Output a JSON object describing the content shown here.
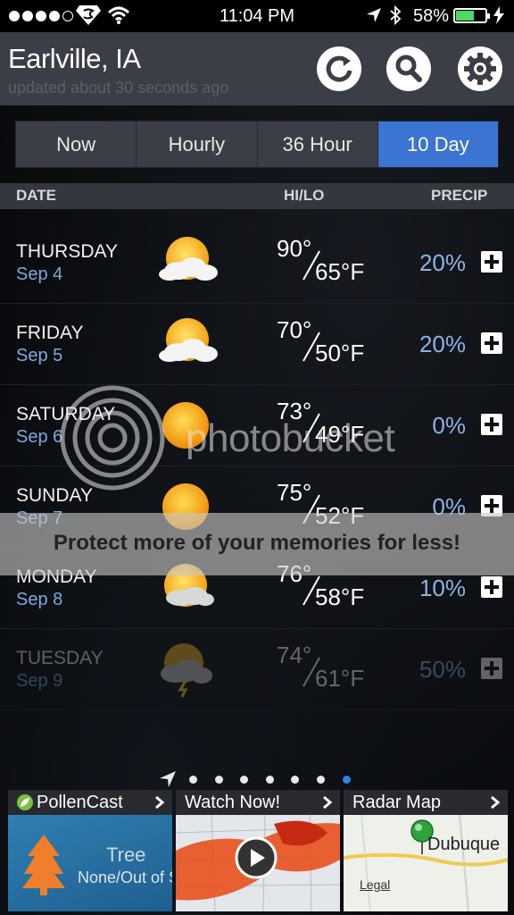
{
  "status_bar": {
    "time": "11:04 PM",
    "battery_pct": "58%",
    "signal_bars": 4,
    "battery_level": 0.58
  },
  "header": {
    "city": "Earlville, IA",
    "updated": "updated about 30 seconds ago"
  },
  "tabs": [
    {
      "label": "Now",
      "active": false
    },
    {
      "label": "Hourly",
      "active": false
    },
    {
      "label": "36 Hour",
      "active": false
    },
    {
      "label": "10 Day",
      "active": true
    }
  ],
  "columns": {
    "date": "DATE",
    "hilo": "HI/LO",
    "precip": "PRECIP"
  },
  "forecast": [
    {
      "day": "THURSDAY",
      "date": "Sep 4",
      "hi": "90°",
      "lo": "65°F",
      "precip": "20%",
      "icon": "partly-cloudy-icon"
    },
    {
      "day": "FRIDAY",
      "date": "Sep 5",
      "hi": "70°",
      "lo": "50°F",
      "precip": "20%",
      "icon": "partly-cloudy-icon"
    },
    {
      "day": "SATURDAY",
      "date": "Sep 6",
      "hi": "73°",
      "lo": "49°F",
      "precip": "0%",
      "icon": "sunny-icon"
    },
    {
      "day": "SUNDAY",
      "date": "Sep 7",
      "hi": "75°",
      "lo": "52°F",
      "precip": "0%",
      "icon": "sunny-icon"
    },
    {
      "day": "MONDAY",
      "date": "Sep 8",
      "hi": "76°",
      "lo": "58°F",
      "precip": "10%",
      "icon": "partly-cloudy-icon"
    },
    {
      "day": "TUESDAY",
      "date": "Sep 9",
      "hi": "74°",
      "lo": "61°F",
      "precip": "50%",
      "icon": "thunderstorm-icon"
    }
  ],
  "watermark": {
    "brand": "photobucket",
    "banner": "Protect more of your memories for less!"
  },
  "pager": {
    "count": 7,
    "active_index": 6
  },
  "cards": {
    "pollen": {
      "title": "PollenCast",
      "label": "Tree",
      "value": "None/Out of S"
    },
    "watch": {
      "title": "Watch Now!"
    },
    "radar": {
      "title": "Radar Map",
      "place": "Dubuque",
      "legal": "Legal"
    }
  },
  "colors": {
    "header_bg": "#3b3e47",
    "tab_active": "#3b74d2",
    "date_text": "#7fa9de",
    "precip_text": "#8fb2e4",
    "pager_active": "#2f86e0"
  }
}
